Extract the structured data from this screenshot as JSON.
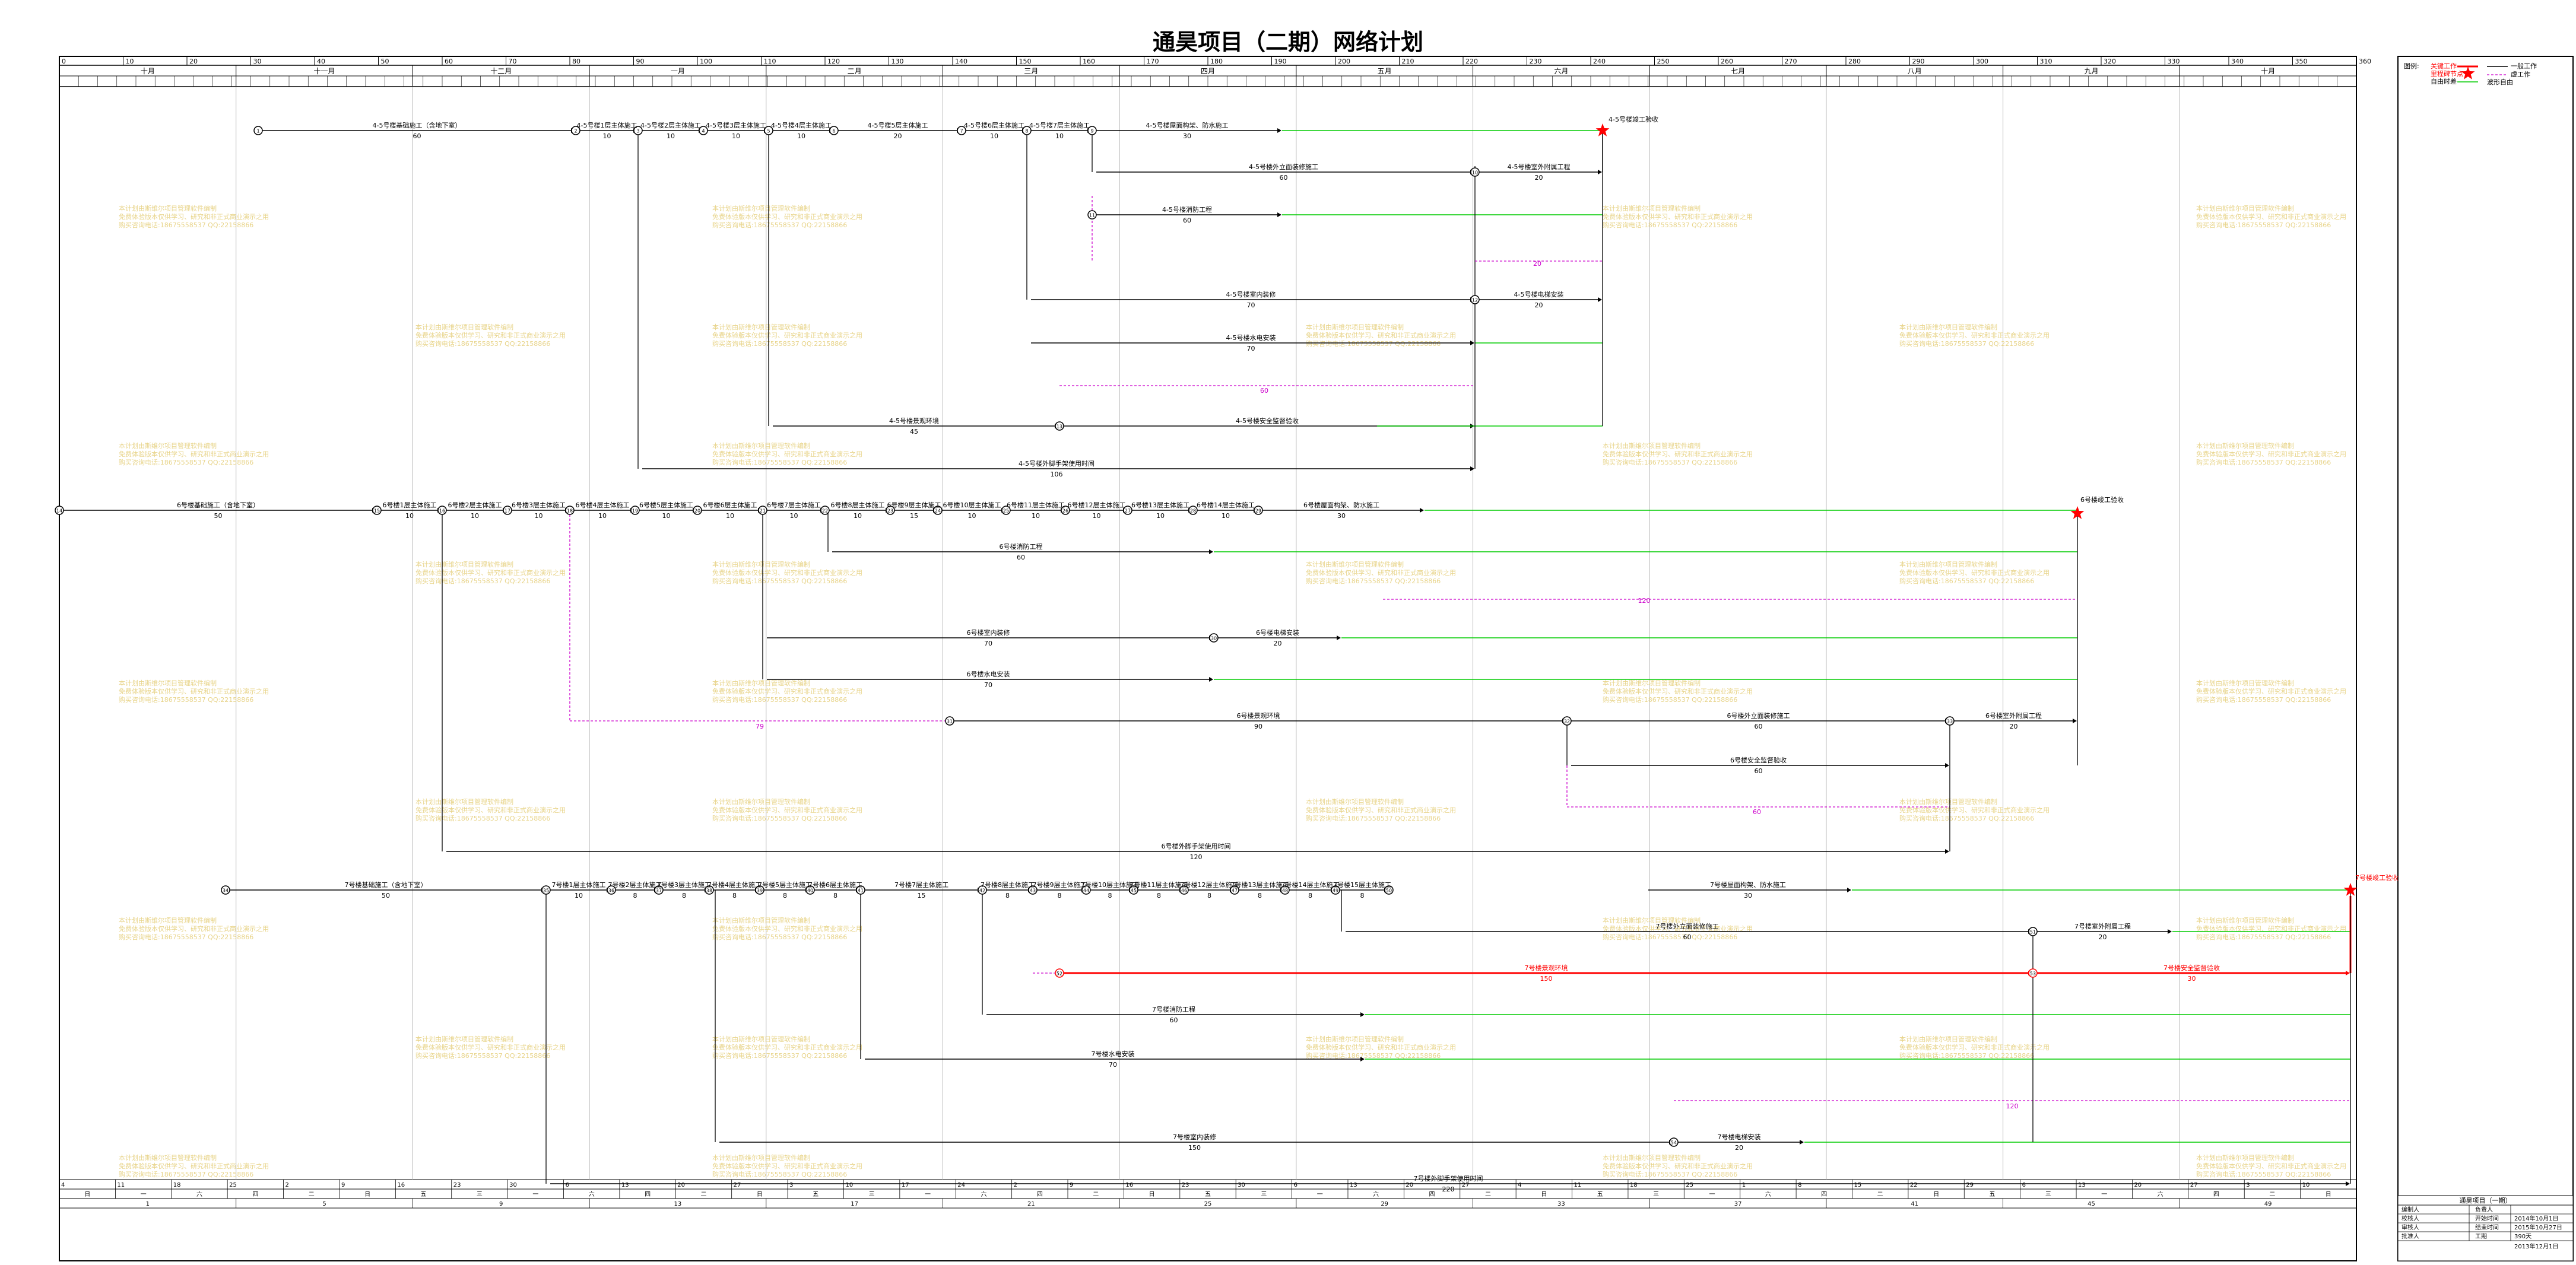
{
  "title": "通昊项目（二期）网络计划",
  "timescale": {
    "months": [
      "十月",
      "十一月",
      "十二月",
      "一月",
      "二月",
      "三月",
      "四月",
      "五月",
      "六月",
      "七月",
      "八月",
      "九月",
      "十月"
    ],
    "top_ticks": [
      "0",
      "10",
      "20",
      "30",
      "40",
      "50",
      "60",
      "70",
      "80",
      "90",
      "100",
      "110",
      "120",
      "130",
      "140",
      "150",
      "160",
      "170",
      "180",
      "190",
      "200",
      "210",
      "220",
      "230",
      "240",
      "250",
      "260",
      "270",
      "280",
      "290",
      "300",
      "310",
      "320",
      "330",
      "340",
      "350",
      "360"
    ],
    "bottom_ticks": [
      "4",
      "11",
      "18",
      "25",
      "2",
      "9",
      "16",
      "23",
      "30",
      "6",
      "13",
      "20",
      "27",
      "3",
      "10",
      "17",
      "24",
      "2",
      "9",
      "16",
      "23",
      "30",
      "6",
      "13",
      "20",
      "27",
      "4",
      "11",
      "18",
      "25",
      "1",
      "8",
      "15",
      "22",
      "29",
      "6",
      "13",
      "20",
      "27",
      "3",
      "10"
    ],
    "weekdays": [
      "日",
      "一",
      "六",
      "四",
      "二",
      "日",
      "五",
      "三",
      "一",
      "六",
      "四",
      "二",
      "日",
      "五",
      "三",
      "一",
      "六",
      "四",
      "二",
      "日",
      "五",
      "三",
      "一",
      "六",
      "四",
      "二",
      "日",
      "五",
      "三",
      "一",
      "六",
      "四",
      "二",
      "日",
      "五",
      "三",
      "一",
      "六",
      "四",
      "二",
      "日"
    ],
    "weeks": [
      "1",
      "5",
      "9",
      "13",
      "17",
      "21",
      "25",
      "29",
      "33",
      "37",
      "41",
      "45",
      "49"
    ]
  },
  "legend": {
    "label": "图例:",
    "critical": "关键工作",
    "milestone": "里程碑节点",
    "normal": "一般工作",
    "virtual": "虚工作",
    "freefloat": "自由时差",
    "free_label": "波形自由"
  },
  "watermark": [
    "本计划由斯维尔项目管理软件编制",
    "免费体验版本仅供学习、研究和非正式商业演示之用",
    "购买咨询电话:18675558537 QQ:22158866"
  ],
  "colors": {
    "critical": "#ff0000",
    "normal": "#000000",
    "virtual": "#cc00cc",
    "float": "#00cc00",
    "watermark": "#e8d48a",
    "milestone": "#ff0000"
  },
  "lane4": {
    "a1": "4-5号楼基础施工（含地下室）",
    "d1": "60",
    "a2": "4-5号楼1层主体施工",
    "d2": "10",
    "a3": "4-5号楼2层主体施工",
    "d3": "10",
    "a4": "4-5号楼3层主体施工",
    "d4": "10",
    "a5": "4-5号楼4层主体施工",
    "d5": "10",
    "a6": "4-5号楼5层主体施工",
    "d6": "20",
    "a7": "4-5号楼6层主体施工",
    "d7": "10",
    "a8": "4-5号楼7层主体施工",
    "d8": "10",
    "a9": "4-5号楼屋面构架、防水施工",
    "d9": "30",
    "a10": "4-5号楼竣工验收",
    "b1": "4-5号楼外立面装修施工",
    "bd1": "60",
    "b2": "4-5号楼室外附属工程",
    "bd2": "20",
    "b3": "4-5号楼消防工程",
    "bd3": "60",
    "b4": "4-5号楼室内装修",
    "bd4": "70",
    "b5": "4-5号楼电梯安装",
    "bd5": "20",
    "b6": "4-5号楼水电安装",
    "bd6": "70",
    "b7": "4-5号楼景观环境",
    "bd7": "45",
    "b8": "4-5号楼安全监督验收",
    "bd8": "",
    "b9": "4-5号楼外脚手架使用时间",
    "bd9": "106",
    "v1": "20",
    "v2": "60"
  },
  "lane6": {
    "a1": "6号楼基础施工（含地下室）",
    "d1": "50",
    "a2": "6号楼1层主体施工",
    "d2": "10",
    "a3": "6号楼2层主体施工",
    "d3": "10",
    "a4": "6号楼3层主体施工",
    "d4": "10",
    "a5": "6号楼4层主体施工",
    "d5": "10",
    "a6": "6号楼5层主体施工",
    "d6": "10",
    "a7": "6号楼6层主体施工",
    "d7": "10",
    "a8": "6号楼7层主体施工",
    "d8": "10",
    "a9": "6号楼8层主体施工",
    "d9": "10",
    "a10": "6号楼9层主体施工",
    "d10": "15",
    "a11": "6号楼10层主体施工",
    "d11": "10",
    "a12": "6号楼11层主体施工",
    "d12": "10",
    "a13": "6号楼12层主体施工",
    "d13": "10",
    "a14": "6号楼13层主体施工",
    "d14": "10",
    "a15": "6号楼14层主体施工",
    "d15": "10",
    "a16": "6号楼屋面构架、防水施工",
    "d16": "30",
    "done": "6号楼竣工验收",
    "b1": "6号楼消防工程",
    "bd1": "60",
    "b2": "6号楼室内装修",
    "bd2": "70",
    "b3": "6号楼电梯安装",
    "bd3": "20",
    "b4": "6号楼水电安装",
    "bd4": "70",
    "b5": "6号楼景观环境",
    "bd5": "90",
    "b6": "6号楼外立面装修施工",
    "bd6": "60",
    "b7": "6号楼室外附属工程",
    "bd7": "20",
    "b8": "6号楼安全监督验收",
    "bd8": "60",
    "b9": "6号楼外脚手架使用时间",
    "bd9": "120",
    "v1": "120",
    "v2": "79",
    "v3": "60"
  },
  "lane7": {
    "a1": "7号楼基础施工（含地下室）",
    "d1": "50",
    "a2": "7号楼1层主体施工",
    "d2": "10",
    "a3": "7号楼2层主体施工",
    "d3": "8",
    "a4": "7号楼3层主体施工",
    "d4": "8",
    "a5": "7号楼4层主体施工",
    "d5": "8",
    "a6": "7号楼5层主体施工",
    "d6": "8",
    "a7": "7号楼6层主体施工",
    "d7": "8",
    "a8": "7号楼7层主体施工",
    "d8": "15",
    "a9": "7号楼8层主体施工",
    "d9": "8",
    "a10": "7号楼9层主体施工",
    "d10": "8",
    "a11": "7号楼10层主体施工",
    "d11": "8",
    "a12": "7号楼11层主体施工",
    "d12": "8",
    "a13": "7号楼12层主体施工",
    "d13": "8",
    "a14": "7号楼13层主体施工",
    "d14": "8",
    "a15": "7号楼14层主体施工",
    "d15": "8",
    "a16": "7号楼15层主体施工",
    "d16": "8",
    "a17": "7号楼屋面构架、防水施工",
    "d17": "30",
    "done": "7号楼竣工验收",
    "b1": "7号楼外立面装修施工",
    "bd1": "60",
    "b2": "7号楼室外附属工程",
    "bd2": "20",
    "b3": "7号楼景观环境",
    "bd3": "150",
    "b4": "7号楼安全监督验收",
    "bd4": "30",
    "b5": "7号楼消防工程",
    "bd5": "60",
    "b6": "7号楼水电安装",
    "bd6": "70",
    "b7": "7号楼室内装修",
    "bd7": "150",
    "b8": "7号楼电梯安装",
    "bd8": "20",
    "b9": "7号楼外脚手架使用时间",
    "bd9": "220",
    "v1": "120"
  },
  "footer": {
    "caption": "通昊项目（一期）",
    "rows": [
      {
        "k": "编制人",
        "v": "负责人"
      },
      {
        "k": "校核人",
        "v": "开始时间"
      },
      {
        "k": "审核人",
        "v": "结束时间"
      },
      {
        "k": "批准人",
        "v": "工期"
      }
    ],
    "start": "2014年10月1日",
    "end": "2015年10月27日",
    "duration": "390天",
    "date": "2013年12月1日"
  }
}
